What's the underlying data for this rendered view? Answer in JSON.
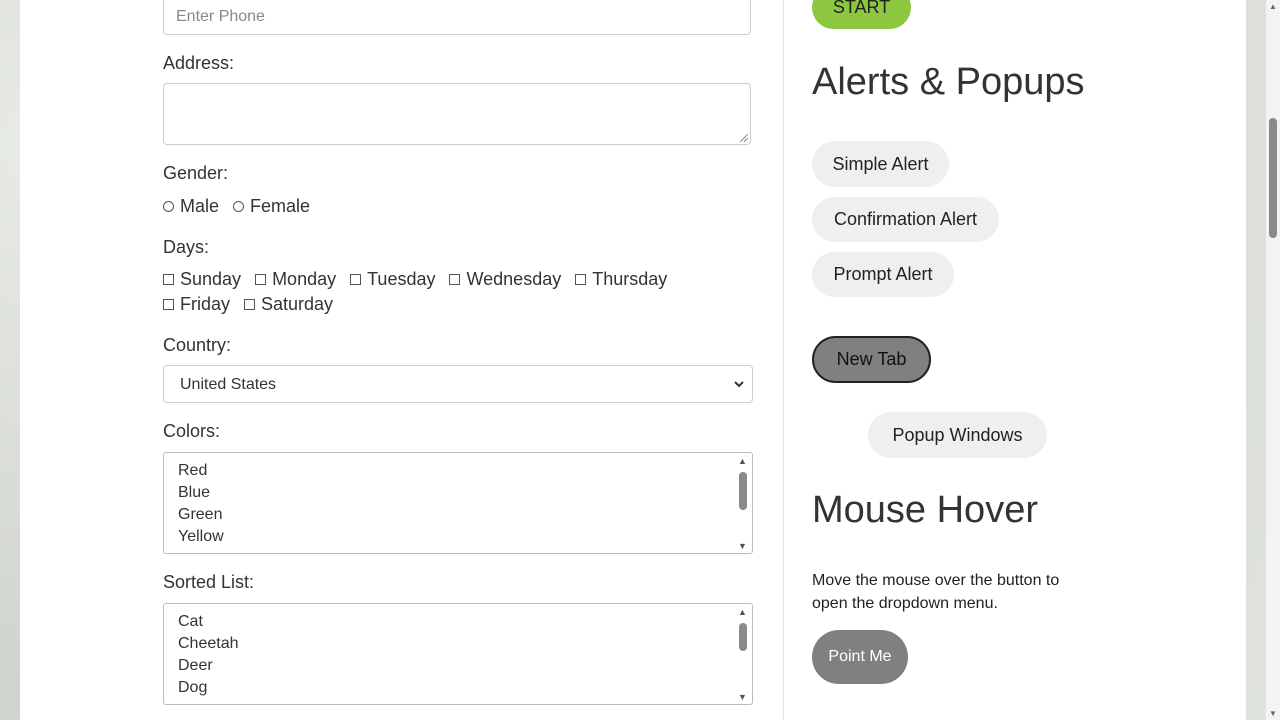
{
  "form": {
    "phone_placeholder": "Enter Phone",
    "address_label": "Address:",
    "gender_label": "Gender:",
    "gender_options": [
      "Male",
      "Female"
    ],
    "days_label": "Days:",
    "days_row1": [
      "Sunday",
      "Monday",
      "Tuesday",
      "Wednesday",
      "Thursday"
    ],
    "days_row2": [
      "Friday",
      "Saturday"
    ],
    "country_label": "Country:",
    "country_value": "United States",
    "colors_label": "Colors:",
    "colors": [
      "Red",
      "Blue",
      "Green",
      "Yellow"
    ],
    "sorted_label": "Sorted List:",
    "sorted": [
      "Cat",
      "Cheetah",
      "Deer",
      "Dog"
    ]
  },
  "side": {
    "start_label": "START",
    "alerts_heading": "Alerts & Popups",
    "simple_alert": "Simple Alert",
    "confirm_alert": "Confirmation Alert",
    "prompt_alert": "Prompt Alert",
    "new_tab": "New Tab",
    "popup_windows": "Popup Windows",
    "hover_heading": "Mouse Hover",
    "hover_text": "Move the mouse over the button to open the dropdown menu.",
    "point_me": "Point Me"
  },
  "colors": {
    "start_green": "#8dc63f",
    "pill_gray": "#efefef",
    "dark_button": "#808080"
  }
}
